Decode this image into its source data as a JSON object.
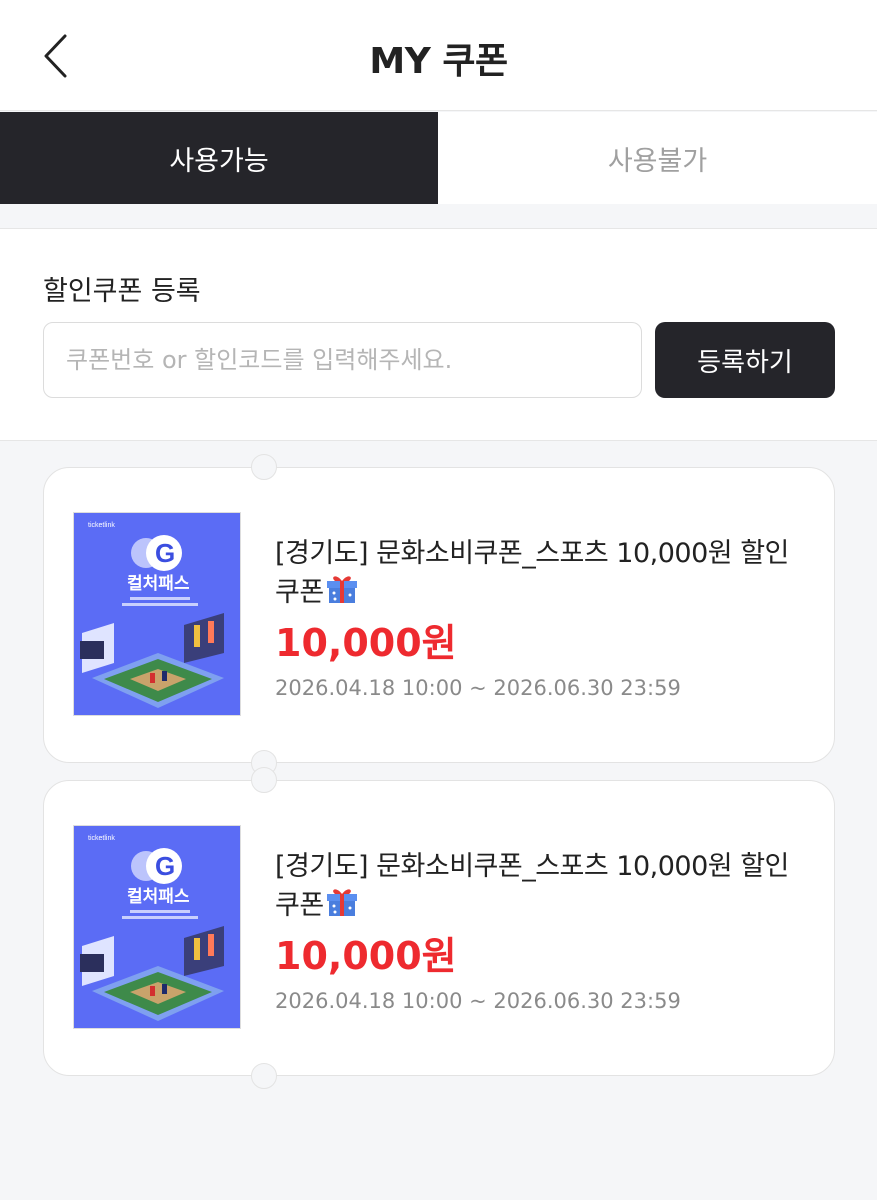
{
  "header": {
    "title": "MY 쿠폰"
  },
  "tabs": [
    {
      "label": "사용가능",
      "active": true
    },
    {
      "label": "사용불가",
      "active": false
    }
  ],
  "register": {
    "label": "할인쿠폰 등록",
    "placeholder": "쿠폰번호 or 할인코드를 입력해주세요.",
    "value": "",
    "button_label": "등록하기"
  },
  "coupons": [
    {
      "name": "[경기도] 문화소비쿠폰_스포츠 10,000원 할인쿠폰",
      "amount": "10,000원",
      "period": "2026.04.18 10:00 ~ 2026.06.30 23:59",
      "thumb": {
        "brand": "ticketlink",
        "title": "컬처패스",
        "letter": "G"
      }
    },
    {
      "name": "[경기도] 문화소비쿠폰_스포츠 10,000원 할인쿠폰",
      "amount": "10,000원",
      "period": "2026.04.18 10:00 ~ 2026.06.30 23:59",
      "thumb": {
        "brand": "ticketlink",
        "title": "컬처패스",
        "letter": "G"
      }
    }
  ],
  "colors": {
    "accent": "#ee2a2f",
    "dark": "#25252a",
    "thumb_bg": "#5b6cf5"
  }
}
